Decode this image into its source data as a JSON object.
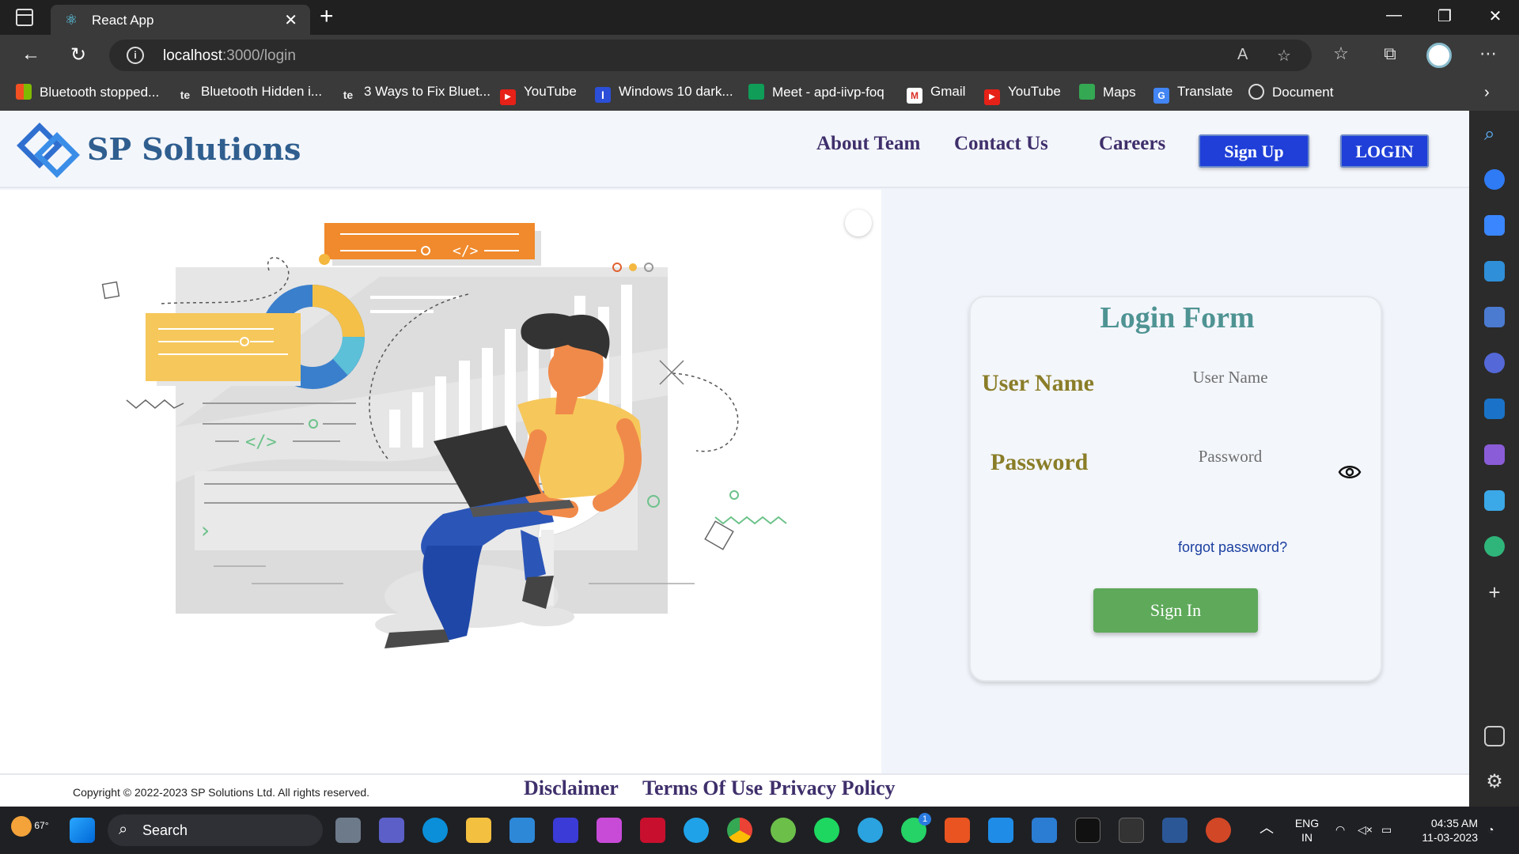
{
  "browser": {
    "tab_title": "React App",
    "url_host": "localhost",
    "url_path": ":3000/login",
    "bookmarks": [
      "Bluetooth stopped...",
      "Bluetooth Hidden i...",
      "3 Ways to Fix Bluet...",
      "YouTube",
      "Windows 10 dark...",
      "Meet - apd-iivp-foq",
      "Gmail",
      "YouTube",
      "Maps",
      "Translate",
      "Document"
    ]
  },
  "site": {
    "brand": "SP Solutions",
    "nav": {
      "about": "About Team",
      "contact": "Contact Us",
      "careers": "Careers",
      "signup": "Sign Up",
      "login": "LOGIN"
    }
  },
  "login_form": {
    "title": "Login Form",
    "username_label": "User Name",
    "username_placeholder": "User Name",
    "password_label": "Password",
    "password_placeholder": "Password",
    "forgot": "forgot password?",
    "signin": "Sign In"
  },
  "footer": {
    "copyright": "Copyright © 2022-2023 SP Solutions Ltd. All rights reserved.",
    "disclaimer": "Disclaimer",
    "terms": "Terms Of Use",
    "privacy": "Privacy Policy"
  },
  "taskbar": {
    "temperature": "67°",
    "search": "Search",
    "lang1": "ENG",
    "lang2": "IN",
    "time": "04:35 AM",
    "date": "11-03-2023",
    "whatsapp_badge": "1"
  },
  "colors": {
    "primary_button": "#1f3fd8",
    "signin_button": "#5ea95a",
    "form_title": "#4f9393",
    "form_labels": "#8a7d28",
    "nav_links": "#3f2f6b"
  }
}
